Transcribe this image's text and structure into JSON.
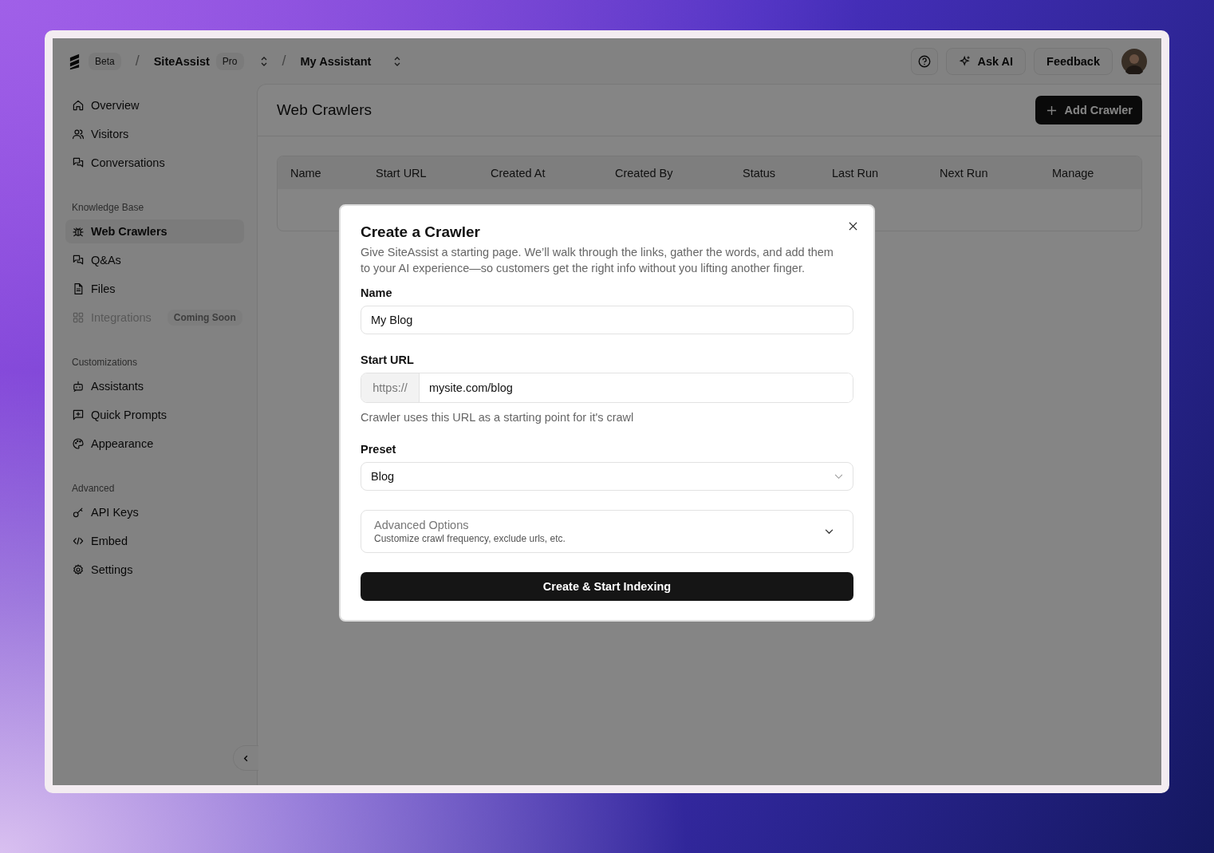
{
  "topbar": {
    "beta_badge": "Beta",
    "breadcrumbs": [
      {
        "separator": "/",
        "label": "SiteAssist",
        "badge": "Pro"
      },
      {
        "separator": "/",
        "label": "My Assistant"
      }
    ],
    "ask_ai": "Ask AI",
    "feedback": "Feedback"
  },
  "sidebar": {
    "sections": [
      {
        "items": [
          {
            "label": "Overview",
            "selected": false,
            "disabled": false
          },
          {
            "label": "Visitors",
            "selected": false,
            "disabled": false
          },
          {
            "label": "Conversations",
            "selected": false,
            "disabled": false
          }
        ]
      },
      {
        "heading": "Knowledge Base",
        "items": [
          {
            "label": "Web Crawlers",
            "selected": true,
            "disabled": false
          },
          {
            "label": "Q&As",
            "selected": false,
            "disabled": false
          },
          {
            "label": "Files",
            "selected": false,
            "disabled": false
          },
          {
            "label": "Integrations",
            "selected": false,
            "disabled": true,
            "badge": "Coming Soon"
          }
        ]
      },
      {
        "heading": "Customizations",
        "items": [
          {
            "label": "Assistants",
            "selected": false,
            "disabled": false
          },
          {
            "label": "Quick Prompts",
            "selected": false,
            "disabled": false
          },
          {
            "label": "Appearance",
            "selected": false,
            "disabled": false
          }
        ]
      },
      {
        "heading": "Advanced",
        "items": [
          {
            "label": "API Keys",
            "selected": false,
            "disabled": false
          },
          {
            "label": "Embed",
            "selected": false,
            "disabled": false
          },
          {
            "label": "Settings",
            "selected": false,
            "disabled": false
          }
        ]
      }
    ]
  },
  "page": {
    "title": "Web Crawlers",
    "add_button": "Add Crawler"
  },
  "table": {
    "columns": [
      "Name",
      "Start URL",
      "Created At",
      "Created By",
      "Status",
      "Last Run",
      "Next Run",
      "Manage"
    ]
  },
  "modal": {
    "title": "Create a Crawler",
    "description": "Give SiteAssist a starting page. We’ll walk through the links, gather the words, and add them to your AI experience—so customers get the right info without you lifting another finger.",
    "name": {
      "label": "Name",
      "value": "My Blog"
    },
    "start_url": {
      "label": "Start URL",
      "prefix": "https://",
      "value": "mysite.com/blog",
      "help": "Crawler uses this URL as a starting point for it's crawl"
    },
    "preset": {
      "label": "Preset",
      "value": "Blog"
    },
    "advanced": {
      "title": "Advanced Options",
      "subtitle": "Customize crawl frequency, exclude urls, etc.",
      "expanded": false
    },
    "submit": "Create & Start Indexing"
  }
}
